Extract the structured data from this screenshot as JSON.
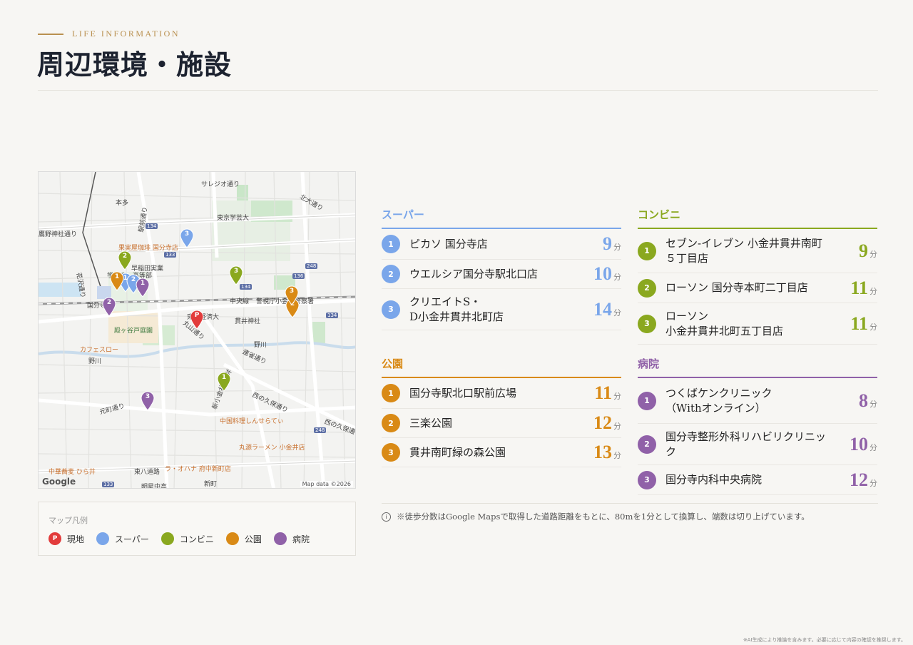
{
  "header": {
    "eyebrow": "LIFE INFORMATION",
    "title": "周辺環境・施設"
  },
  "colors": {
    "gold": "#b9904f",
    "super": "#7aa6ea",
    "conveni": "#8aa81f",
    "park": "#d98a16",
    "hospital": "#9061a8",
    "current": "#e23b3b"
  },
  "map": {
    "labels": {
      "l1": "サレジオ通り",
      "l2": "本多",
      "l3": "北大通り",
      "l4": "東京学芸大",
      "l5": "鷹野神社通り",
      "l6": "駅前通り",
      "l7": "果実屋珈琲 国分寺店",
      "l8": "早稲田実業",
      "l9": "学校中・高等部",
      "l10": "花沢通り",
      "l11": "国分寺",
      "l12": "中央線",
      "l13": "警視庁小金井警察署",
      "l14": "東京経済大",
      "l15": "貫井神社",
      "l16": "殿ヶ谷戸庭園",
      "l17": "丸山通り",
      "l18": "野川",
      "l19": "カフェスロー",
      "l20": "野川",
      "l21": "小金井",
      "l22": "連雀通り",
      "l23": "新小金井街道",
      "l24": "西の久保通り",
      "l25": "元町通り",
      "l26": "中国料理しんせらてぃ",
      "l27": "西の久保通",
      "l28": "丸源ラーメン 小金井店",
      "l29": "中華蕎麦 ひら井",
      "l30": "東八道路",
      "l31": "ラ・オハナ 府中新町店",
      "l32": "明星中高",
      "l33": "新町",
      "road1": "134",
      "road2": "133",
      "road3": "248",
      "road4": "136",
      "road5": "134",
      "road6": "134",
      "road7": "248",
      "road8": "133"
    },
    "google": "Google",
    "map_data": "Map data ©2026",
    "pins": {
      "p_current": "P",
      "s1": "1",
      "s2": "2",
      "s3": "3",
      "c1": "1",
      "c2": "2",
      "c3": "3",
      "pk1": "1",
      "pk2": "2",
      "pk3": "3",
      "h1": "1",
      "h2": "2",
      "h3": "3"
    }
  },
  "legend": {
    "title": "マップ凡例",
    "current_symbol": "P",
    "items": [
      "現地",
      "スーパー",
      "コンビニ",
      "公園",
      "病院"
    ]
  },
  "categories": {
    "super": {
      "title": "スーパー",
      "unit": "分",
      "items": [
        {
          "n": "1",
          "name": "ピカソ 国分寺店",
          "min": "9"
        },
        {
          "n": "2",
          "name": "ウエルシア国分寺駅北口店",
          "min": "10"
        },
        {
          "n": "3",
          "name": "クリエイトS・\nD小金井貫井北町店",
          "min": "14"
        }
      ]
    },
    "conveni": {
      "title": "コンビニ",
      "unit": "分",
      "items": [
        {
          "n": "1",
          "name": "セブン-イレブン 小金井貫井南町\n５丁目店",
          "min": "9"
        },
        {
          "n": "2",
          "name": "ローソン 国分寺本町二丁目店",
          "min": "11"
        },
        {
          "n": "3",
          "name": "ローソン\n小金井貫井北町五丁目店",
          "min": "11"
        }
      ]
    },
    "park": {
      "title": "公園",
      "unit": "分",
      "items": [
        {
          "n": "1",
          "name": "国分寺駅北口駅前広場",
          "min": "11"
        },
        {
          "n": "2",
          "name": "三楽公園",
          "min": "12"
        },
        {
          "n": "3",
          "name": "貫井南町緑の森公園",
          "min": "13"
        }
      ]
    },
    "hospital": {
      "title": "病院",
      "unit": "分",
      "items": [
        {
          "n": "1",
          "name": "つくばケンクリニック\n（Withオンライン）",
          "min": "8"
        },
        {
          "n": "2",
          "name": "国分寺整形外科リハビリクリニッ\nク",
          "min": "10"
        },
        {
          "n": "3",
          "name": "国分寺内科中央病院",
          "min": "12"
        }
      ]
    }
  },
  "note": "※徒歩分数はGoogle Mapsで取得した道路距離をもとに、80mを1分として換算し、端数は切り上げています。",
  "note_icon": "i",
  "footer": "※AI生成により推論を含みます。必要に応じて内容の確認を推奨します。"
}
